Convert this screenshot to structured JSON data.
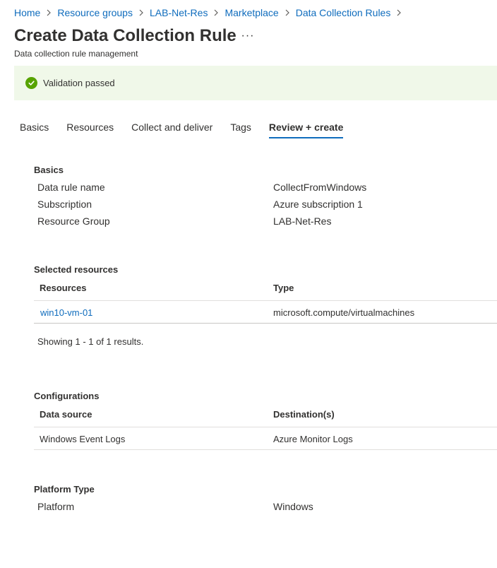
{
  "breadcrumb": {
    "items": [
      "Home",
      "Resource groups",
      "LAB-Net-Res",
      "Marketplace",
      "Data Collection Rules"
    ]
  },
  "header": {
    "title": "Create Data Collection Rule",
    "more_label": "···",
    "subtitle": "Data collection rule management"
  },
  "banner": {
    "message": "Validation passed",
    "status_color": "#57a300"
  },
  "tabs": {
    "items": [
      "Basics",
      "Resources",
      "Collect and deliver",
      "Tags",
      "Review + create"
    ],
    "active": "Review + create"
  },
  "basics": {
    "title": "Basics",
    "rows": [
      {
        "label": "Data rule name",
        "value": "CollectFromWindows"
      },
      {
        "label": "Subscription",
        "value": "Azure subscription 1"
      },
      {
        "label": "Resource Group",
        "value": "LAB-Net-Res"
      }
    ]
  },
  "selected_resources": {
    "title": "Selected resources",
    "columns": [
      "Resources",
      "Type"
    ],
    "rows": [
      {
        "resource": "win10-vm-01",
        "type": "microsoft.compute/virtualmachines"
      }
    ],
    "results_text": "Showing 1 - 1 of 1 results."
  },
  "configurations": {
    "title": "Configurations",
    "columns": [
      "Data source",
      "Destination(s)"
    ],
    "rows": [
      {
        "source": "Windows Event Logs",
        "destination": "Azure Monitor Logs"
      }
    ]
  },
  "platform": {
    "title": "Platform Type",
    "rows": [
      {
        "label": "Platform",
        "value": "Windows"
      }
    ]
  },
  "colors": {
    "link": "#0f6cbd",
    "banner_bg": "#f0f8e9",
    "text": "#323130"
  }
}
